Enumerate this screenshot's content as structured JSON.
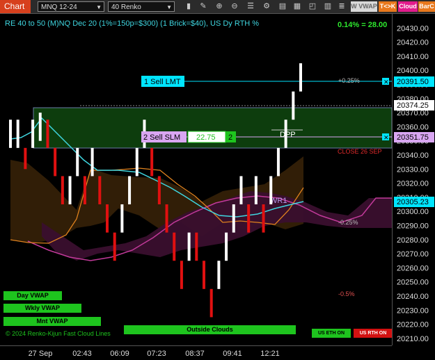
{
  "toolbar": {
    "chart_label": "Chart",
    "instrument": "MNQ 12-24",
    "bar_type": "40 Renko",
    "wvwap_label": "W VWAP",
    "tok_label": "T<>K",
    "cloud_label": "Cloud",
    "barc_label": "BarC"
  },
  "header": {
    "title": "RE 40 to 50 (M)NQ Dec 20 (1%=150p=$300) (1 Brick=$40), US Dy RTH %",
    "pnl": "0.14% = 28.00"
  },
  "orders": {
    "sell_lmt_label": "1 Sell LMT",
    "sell_slm_label": "2 Sell SLM",
    "slm_value": "22.75",
    "slm_qty": "2"
  },
  "annotations": {
    "plus025": "+0.25%",
    "minus025": "-0.25%",
    "minus05": "-0.5%",
    "close_label": "CLOSE 26 SEP",
    "dpp": "DPP",
    "wr1": "WR1",
    "sma_label": "© 2024 Renko-Kijun Fast Cloud Lines"
  },
  "overlay_labels": {
    "day_vwap": "Day VWAP",
    "wkly_vwap": "Wkly VWAP",
    "mnt_vwap": "Mnt VWAP",
    "outside_clouds": "Outside Clouds",
    "us_eth_on": "US ETH ON",
    "us_rth_on": "US RTH ON"
  },
  "price_tags": {
    "sell_lmt_price": "20391.50",
    "current_price": "20374.25",
    "sell_slm_price": "20351.75",
    "wr1_price": "20305.23"
  },
  "colors": {
    "up_brick": "#ffffff",
    "down_brick": "#e01010",
    "cloud_bull": "#0d3d0d",
    "cloud_bear": "#3a2308",
    "cloud_purple": "#3a0f2e",
    "cyan_line": "#3fd6e0",
    "orange_line": "#e0821e",
    "magenta_line": "#c23a9a",
    "accent_cyan": "#00e5ff",
    "slm_purple": "#d9a6f2",
    "green_text": "#2ee82e"
  },
  "chart_data": {
    "type": "candlestick",
    "subtype": "renko",
    "ylim": [
      20205,
      20440
    ],
    "yticks": [
      20210.0,
      20220.0,
      20230.0,
      20240.0,
      20250.0,
      20260.0,
      20270.0,
      20280.0,
      20290.0,
      20300.0,
      20310.0,
      20320.0,
      20330.0,
      20340.0,
      20350.0,
      20360.0,
      20370.0,
      20380.0,
      20390.0,
      20400.0,
      20410.0,
      20420.0,
      20430.0
    ],
    "xticks": [
      "27 Sep",
      "02:43",
      "06:09",
      "07:23",
      "08:37",
      "09:41",
      "12:21"
    ],
    "grid": false,
    "bricks": [
      {
        "o": 20345,
        "c": 20365,
        "dir": "up"
      },
      {
        "o": 20345,
        "c": 20365,
        "dir": "up"
      },
      {
        "o": 20345,
        "c": 20330,
        "dir": "down"
      },
      {
        "o": 20345,
        "c": 20365,
        "dir": "up"
      },
      {
        "o": 20350,
        "c": 20370,
        "dir": "up"
      },
      {
        "o": 20365,
        "c": 20345,
        "dir": "down"
      },
      {
        "o": 20345,
        "c": 20325,
        "dir": "down"
      },
      {
        "o": 20325,
        "c": 20305,
        "dir": "down"
      },
      {
        "o": 20305,
        "c": 20325,
        "dir": "up"
      },
      {
        "o": 20325,
        "c": 20345,
        "dir": "up"
      },
      {
        "o": 20325,
        "c": 20305,
        "dir": "down"
      },
      {
        "o": 20325,
        "c": 20345,
        "dir": "up"
      },
      {
        "o": 20325,
        "c": 20305,
        "dir": "down"
      },
      {
        "o": 20305,
        "c": 20285,
        "dir": "down"
      },
      {
        "o": 20285,
        "c": 20265,
        "dir": "down"
      },
      {
        "o": 20285,
        "c": 20305,
        "dir": "up"
      },
      {
        "o": 20305,
        "c": 20325,
        "dir": "up"
      },
      {
        "o": 20325,
        "c": 20345,
        "dir": "up"
      },
      {
        "o": 20345,
        "c": 20365,
        "dir": "up"
      },
      {
        "o": 20345,
        "c": 20325,
        "dir": "down"
      },
      {
        "o": 20325,
        "c": 20305,
        "dir": "down"
      },
      {
        "o": 20305,
        "c": 20285,
        "dir": "down"
      },
      {
        "o": 20285,
        "c": 20265,
        "dir": "down"
      },
      {
        "o": 20265,
        "c": 20245,
        "dir": "down"
      },
      {
        "o": 20265,
        "c": 20285,
        "dir": "up"
      },
      {
        "o": 20285,
        "c": 20265,
        "dir": "down"
      },
      {
        "o": 20265,
        "c": 20245,
        "dir": "down"
      },
      {
        "o": 20245,
        "c": 20225,
        "dir": "down"
      },
      {
        "o": 20245,
        "c": 20265,
        "dir": "up"
      },
      {
        "o": 20265,
        "c": 20285,
        "dir": "up"
      },
      {
        "o": 20285,
        "c": 20305,
        "dir": "up"
      },
      {
        "o": 20305,
        "c": 20325,
        "dir": "up"
      },
      {
        "o": 20305,
        "c": 20285,
        "dir": "down"
      },
      {
        "o": 20305,
        "c": 20325,
        "dir": "up"
      },
      {
        "o": 20305,
        "c": 20285,
        "dir": "down"
      },
      {
        "o": 20305,
        "c": 20325,
        "dir": "up"
      },
      {
        "o": 20325,
        "c": 20345,
        "dir": "up"
      },
      {
        "o": 20345,
        "c": 20365,
        "dir": "up"
      },
      {
        "o": 20365,
        "c": 20385,
        "dir": "up"
      },
      {
        "o": 20385,
        "c": 20405,
        "dir": "up"
      }
    ],
    "levels": [
      {
        "label": "+0.25%",
        "price": 20391.5
      },
      {
        "label": "CLOSE 26 SEP",
        "price": 20344
      },
      {
        "label": "-0.25%",
        "price": 20293
      },
      {
        "label": "-0.5%",
        "price": 20243
      }
    ]
  }
}
